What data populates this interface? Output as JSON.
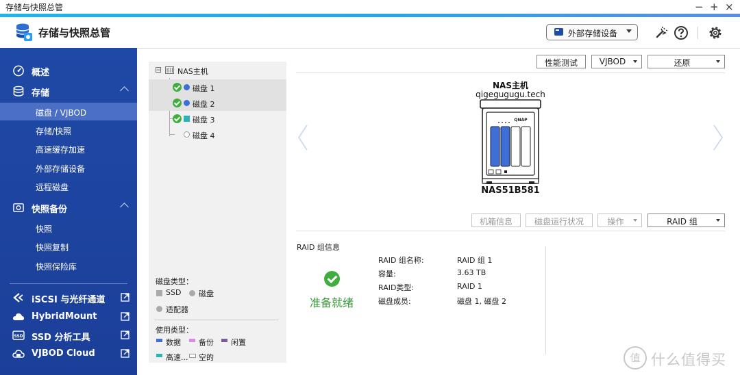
{
  "window": {
    "title": "存储与快照总管",
    "controls": {
      "minimize": "−",
      "maximize": "+",
      "close": "×"
    }
  },
  "header": {
    "app_title": "存储与快照总管",
    "external_device_button": "外部存储设备",
    "icons": [
      "app-logo-icon",
      "wrench-icon",
      "help-icon",
      "gear-icon"
    ]
  },
  "sidebar": {
    "overview": "概述",
    "storage": {
      "label": "存储",
      "items": [
        "磁盘 / VJBOD",
        "存储/快照",
        "高速缓存加速",
        "外部存储设备",
        "远程磁盘"
      ],
      "active_index": 0
    },
    "snapshot_backup": {
      "label": "快照备份",
      "items": [
        "快照",
        "快照复制",
        "快照保险库"
      ]
    },
    "external_apps": [
      "iSCSI 与光纤通道",
      "HybridMount",
      "SSD 分析工具",
      "VJBOD Cloud"
    ]
  },
  "disk_tree": {
    "root": "NAS主机",
    "expand_symbol": "⊟",
    "disks": [
      {
        "label": "磁盘 1",
        "status": "ok",
        "type_color": "#3e6fd8",
        "selected": true
      },
      {
        "label": "磁盘 2",
        "status": "ok",
        "type_color": "#3e6fd8",
        "selected": true
      },
      {
        "label": "磁盘 3",
        "status": "ok",
        "type_color": "#2bb3b8",
        "selected": false
      },
      {
        "label": "磁盘 4",
        "status": "empty",
        "type_color": "#ffffff",
        "selected": false
      }
    ]
  },
  "legend": {
    "disk_type_title": "磁盘类型：",
    "disk_types": [
      "SSD",
      "磁盘",
      "适配器"
    ],
    "usage_type_title": "使用类型：",
    "usage_types": [
      {
        "label": "数据",
        "color": "#3e6fd8"
      },
      {
        "label": "备份",
        "color": "#d98be0"
      },
      {
        "label": "闲置",
        "color": "#7a5a9a"
      },
      {
        "label": "高速...",
        "color": "#2bb3b8"
      },
      {
        "label": "空的",
        "color": "#ffffff"
      }
    ]
  },
  "toolbar": {
    "perf_test": "性能测试",
    "vjbod": "VJBOD",
    "restore": "还原"
  },
  "nas": {
    "name": "NAS主机",
    "hostname": "qigegugugu.tech",
    "model": "NAS51B581",
    "brand": "QNAP"
  },
  "actions": {
    "enclosure_info": "机箱信息",
    "disk_health": "磁盘运行状况",
    "operate": "操作",
    "raid_group_select": "RAID 组"
  },
  "raid_info": {
    "heading": "RAID 组信息",
    "status": "准备就绪",
    "fields": [
      {
        "key": "RAID 组名称:",
        "value": "RAID 组 1"
      },
      {
        "key": "容量:",
        "value": "3.63 TB"
      },
      {
        "key": "RAID类型:",
        "value": "RAID 1"
      },
      {
        "key": "磁盘成员:",
        "value": "磁盘 1, 磁盘 2"
      }
    ]
  },
  "watermark": {
    "badge": "值",
    "text": "什么值得买"
  }
}
